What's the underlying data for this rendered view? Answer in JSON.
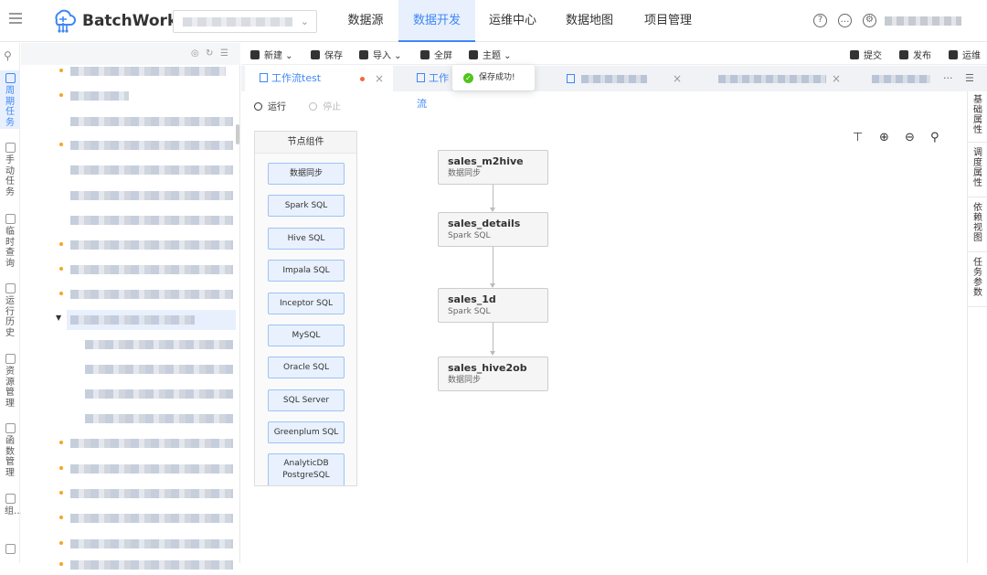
{
  "app": {
    "name": "BatchWorks",
    "brand_color": "#3f87f5"
  },
  "nav": [
    "数据源",
    "数据开发",
    "运维中心",
    "数据地图",
    "项目管理"
  ],
  "left_rail": [
    "周期任务",
    "手动任务",
    "临时查询",
    "运行历史",
    "资源管理",
    "函数管理",
    "组…"
  ],
  "toolbar": {
    "new": "新建",
    "save": "保存",
    "import": "导入",
    "fullscreen": "全屏",
    "theme": "主题",
    "submit": "提交",
    "publish": "发布",
    "ops": "运维"
  },
  "tabs": {
    "active": "工作流test",
    "second": "工作流"
  },
  "toast": {
    "message": "保存成功!"
  },
  "runbar": {
    "run": "运行",
    "stop": "停止"
  },
  "palette": {
    "title": "节点组件",
    "items": [
      "数据同步",
      "Spark SQL",
      "Hive SQL",
      "Impala SQL",
      "Inceptor SQL",
      "MySQL",
      "Oracle SQL",
      "SQL Server",
      "Greenplum SQL"
    ],
    "last_line1": "AnalyticDB",
    "last_line2": "PostgreSQL"
  },
  "nodes": [
    {
      "name": "sales_m2hive",
      "type": "数据同步"
    },
    {
      "name": "sales_details",
      "type": "Spark SQL"
    },
    {
      "name": "sales_1d",
      "type": "Spark SQL"
    },
    {
      "name": "sales_hive2ob",
      "type": "数据同步"
    }
  ],
  "right_rail": [
    "基础属性",
    "调度属性",
    "依赖视图",
    "任务参数"
  ]
}
